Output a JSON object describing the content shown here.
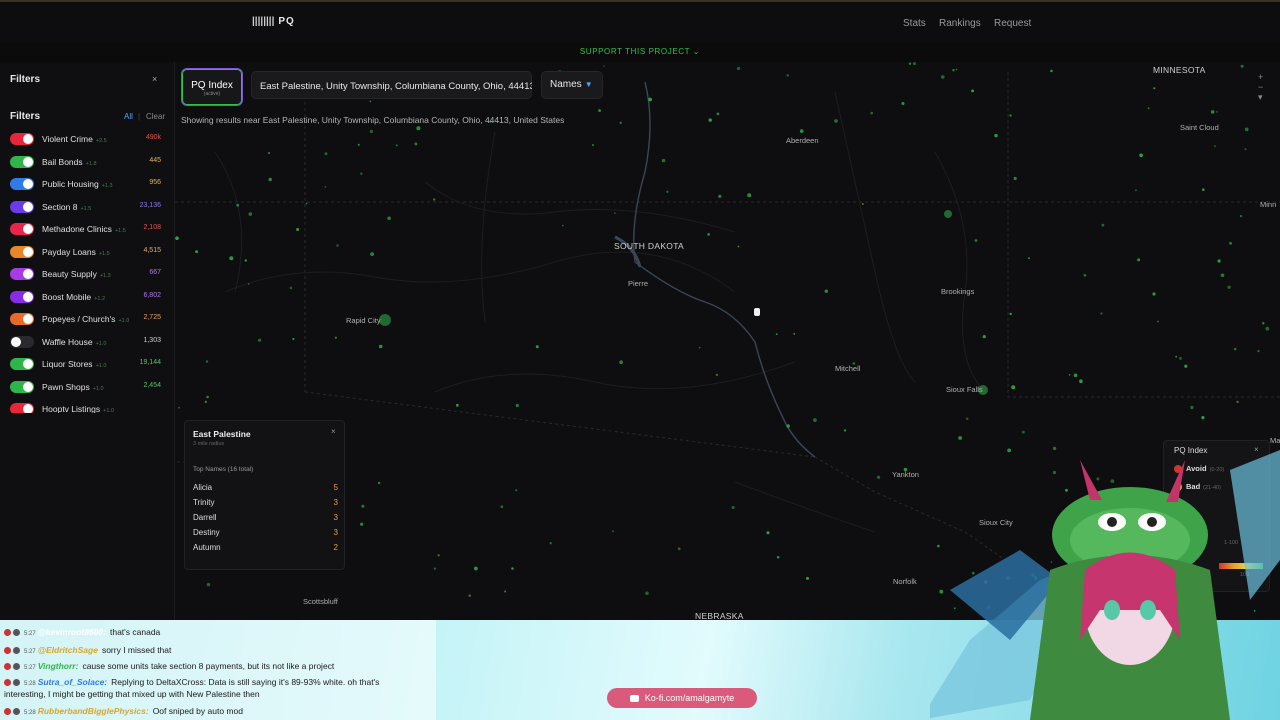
{
  "app": {
    "logo_text": "PQ",
    "logo_bars": "||||||||"
  },
  "nav": {
    "stats": "Stats",
    "rankings": "Rankings",
    "request": "Request"
  },
  "support_banner": "SUPPORT THIS PROJECT ⌄",
  "sidebar": {
    "header": "Filters",
    "close": "×",
    "filters_title": "Filters",
    "all": "All",
    "sep": "|",
    "clear": "Clear",
    "items": [
      {
        "label": "Violent Crime",
        "mult": "+2.5",
        "count": "490k",
        "color": "#e8263a",
        "count_color": "#e05555",
        "on": true
      },
      {
        "label": "Bail Bonds",
        "mult": "+1.8",
        "count": "445",
        "color": "#2fb54a",
        "count_color": "#e8b15a",
        "on": true
      },
      {
        "label": "Public Housing",
        "mult": "+1.3",
        "count": "956",
        "color": "#2f7be8",
        "count_color": "#e8b15a",
        "on": true
      },
      {
        "label": "Section 8",
        "mult": "+1.5",
        "count": "23,136",
        "color": "#6a3be8",
        "count_color": "#8a7be8",
        "on": true
      },
      {
        "label": "Methadone Clinics",
        "mult": "+1.5",
        "count": "2,108",
        "color": "#e8264a",
        "count_color": "#e05555",
        "on": true
      },
      {
        "label": "Payday Loans",
        "mult": "+1.5",
        "count": "4,515",
        "color": "#e8862a",
        "count_color": "#e8b15a",
        "on": true
      },
      {
        "label": "Beauty Supply",
        "mult": "+1.3",
        "count": "667",
        "color": "#a83be8",
        "count_color": "#b57be8",
        "on": true
      },
      {
        "label": "Boost Mobile",
        "mult": "+1.2",
        "count": "6,802",
        "color": "#8a2be8",
        "count_color": "#b57be8",
        "on": true
      },
      {
        "label": "Popeyes / Church's",
        "mult": "+1.0",
        "count": "2,725",
        "color": "#e86a2a",
        "count_color": "#e8a05a",
        "on": true
      },
      {
        "label": "Waffle House",
        "mult": "+1.0",
        "count": "1,303",
        "color": "#2a2a2e",
        "count_color": "#cccccc",
        "on": false
      },
      {
        "label": "Liquor Stores",
        "mult": "+1.0",
        "count": "19,144",
        "color": "#2fb54a",
        "count_color": "#55c46a",
        "on": true
      },
      {
        "label": "Pawn Shops",
        "mult": "+1.0",
        "count": "2,454",
        "color": "#2fb54a",
        "count_color": "#55c46a",
        "on": true
      },
      {
        "label": "Hooptv Listings",
        "mult": "+1.0",
        "count": "",
        "color": "#e8263a",
        "count_color": "#e05555",
        "on": true
      }
    ]
  },
  "pq_button": {
    "label": "PQ Index",
    "sub": "(active)"
  },
  "search": {
    "value": "East Palestine, Unity Township, Columbiana County, Ohio, 44413, United States"
  },
  "names_dropdown": {
    "label": "Names",
    "arrow": "▼"
  },
  "results_text": "Showing results near East Palestine, Unity Township, Columbiana County, Ohio, 44413, United States",
  "map_labels": {
    "minnesota": "MINNESOTA",
    "saint_cloud": "Saint Cloud",
    "minn": "Minn",
    "aberdeen": "Aberdeen",
    "south_dakota": "SOUTH DAKOTA",
    "pierre": "Pierre",
    "rapid_city": "Rapid City",
    "brookings": "Brookings",
    "mitchell": "Mitchell",
    "sioux_falls": "Sioux Falls",
    "yankton": "Yankton",
    "sioux_city": "Sioux City",
    "norfolk": "Norfolk",
    "nebraska": "NEBRASKA",
    "scottsbluff": "Scottsbluff",
    "ma": "Ma"
  },
  "popup": {
    "title": "East Palestine",
    "subtitle": "3 mile radius",
    "close": "×",
    "heading": "Top Names (16 total)",
    "names": [
      {
        "name": "Alicia",
        "count": "5"
      },
      {
        "name": "Trinity",
        "count": "3"
      },
      {
        "name": "Darrell",
        "count": "3"
      },
      {
        "name": "Destiny",
        "count": "3"
      },
      {
        "name": "Autumn",
        "count": "2"
      }
    ]
  },
  "legend": {
    "title": "PQ Index",
    "close": "×",
    "items": [
      {
        "label": "Avoid",
        "range": "(0-20)",
        "color": "#d0352b"
      },
      {
        "label": "Bad",
        "range": "(21-40)",
        "color": "#e8a12e"
      }
    ],
    "scale_low": "1-100",
    "scale_high": "100"
  },
  "chat": [
    {
      "time": "5:27",
      "user": "@kevinroot8680:",
      "msg": "that's canada",
      "ucolor": "#ffffff"
    },
    {
      "time": "5:27",
      "user": "@EldritchSage",
      "msg": "sorry I missed that",
      "ucolor": "#d8a62a"
    },
    {
      "time": "5:27",
      "user": "Vingthorr:",
      "msg": "cause some units take section 8 payments, but its not like a project",
      "ucolor": "#2fb54a"
    },
    {
      "time": "5:28",
      "user": "Sutra_of_Solace:",
      "msg": "Replying to DeltaXCross: Data is still saying it's 89-93% white. oh that's",
      "ucolor": "#2f7be8"
    },
    {
      "time": "",
      "user": "",
      "msg": "interesting, I might be getting that mixed up with New Palestine then",
      "ucolor": "#111111"
    },
    {
      "time": "5:28",
      "user": "RubberbandBigglePhysics:",
      "msg": "Oof sniped by auto mod",
      "ucolor": "#d8a62a"
    }
  ],
  "kofi": "Ko-fi.com/amalgamyte"
}
